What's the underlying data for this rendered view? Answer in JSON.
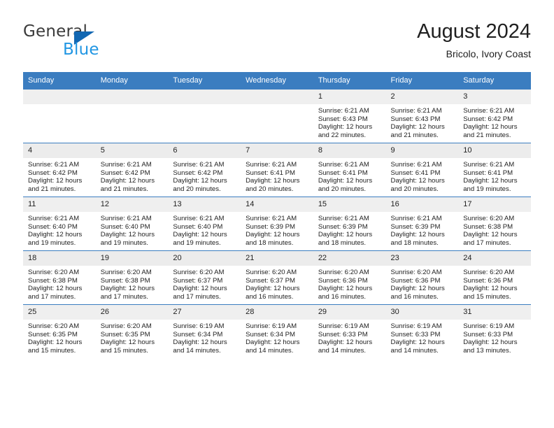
{
  "brand": {
    "name_top": "General",
    "name_bottom": "Blue",
    "accent_dark": "#1267b2",
    "accent_light": "#2196e3"
  },
  "header": {
    "title": "August 2024",
    "subtitle": "Bricolo, Ivory Coast",
    "header_bg": "#3b7dc0"
  },
  "calendar": {
    "weekday_headers": [
      "Sunday",
      "Monday",
      "Tuesday",
      "Wednesday",
      "Thursday",
      "Friday",
      "Saturday"
    ],
    "weeks": [
      [
        {
          "day": "",
          "lines": []
        },
        {
          "day": "",
          "lines": []
        },
        {
          "day": "",
          "lines": []
        },
        {
          "day": "",
          "lines": []
        },
        {
          "day": "1",
          "lines": [
            "Sunrise: 6:21 AM",
            "Sunset: 6:43 PM",
            "Daylight: 12 hours",
            "and 22 minutes."
          ]
        },
        {
          "day": "2",
          "lines": [
            "Sunrise: 6:21 AM",
            "Sunset: 6:43 PM",
            "Daylight: 12 hours",
            "and 21 minutes."
          ]
        },
        {
          "day": "3",
          "lines": [
            "Sunrise: 6:21 AM",
            "Sunset: 6:42 PM",
            "Daylight: 12 hours",
            "and 21 minutes."
          ]
        }
      ],
      [
        {
          "day": "4",
          "lines": [
            "Sunrise: 6:21 AM",
            "Sunset: 6:42 PM",
            "Daylight: 12 hours",
            "and 21 minutes."
          ]
        },
        {
          "day": "5",
          "lines": [
            "Sunrise: 6:21 AM",
            "Sunset: 6:42 PM",
            "Daylight: 12 hours",
            "and 21 minutes."
          ]
        },
        {
          "day": "6",
          "lines": [
            "Sunrise: 6:21 AM",
            "Sunset: 6:42 PM",
            "Daylight: 12 hours",
            "and 20 minutes."
          ]
        },
        {
          "day": "7",
          "lines": [
            "Sunrise: 6:21 AM",
            "Sunset: 6:41 PM",
            "Daylight: 12 hours",
            "and 20 minutes."
          ]
        },
        {
          "day": "8",
          "lines": [
            "Sunrise: 6:21 AM",
            "Sunset: 6:41 PM",
            "Daylight: 12 hours",
            "and 20 minutes."
          ]
        },
        {
          "day": "9",
          "lines": [
            "Sunrise: 6:21 AM",
            "Sunset: 6:41 PM",
            "Daylight: 12 hours",
            "and 20 minutes."
          ]
        },
        {
          "day": "10",
          "lines": [
            "Sunrise: 6:21 AM",
            "Sunset: 6:41 PM",
            "Daylight: 12 hours",
            "and 19 minutes."
          ]
        }
      ],
      [
        {
          "day": "11",
          "lines": [
            "Sunrise: 6:21 AM",
            "Sunset: 6:40 PM",
            "Daylight: 12 hours",
            "and 19 minutes."
          ]
        },
        {
          "day": "12",
          "lines": [
            "Sunrise: 6:21 AM",
            "Sunset: 6:40 PM",
            "Daylight: 12 hours",
            "and 19 minutes."
          ]
        },
        {
          "day": "13",
          "lines": [
            "Sunrise: 6:21 AM",
            "Sunset: 6:40 PM",
            "Daylight: 12 hours",
            "and 19 minutes."
          ]
        },
        {
          "day": "14",
          "lines": [
            "Sunrise: 6:21 AM",
            "Sunset: 6:39 PM",
            "Daylight: 12 hours",
            "and 18 minutes."
          ]
        },
        {
          "day": "15",
          "lines": [
            "Sunrise: 6:21 AM",
            "Sunset: 6:39 PM",
            "Daylight: 12 hours",
            "and 18 minutes."
          ]
        },
        {
          "day": "16",
          "lines": [
            "Sunrise: 6:21 AM",
            "Sunset: 6:39 PM",
            "Daylight: 12 hours",
            "and 18 minutes."
          ]
        },
        {
          "day": "17",
          "lines": [
            "Sunrise: 6:20 AM",
            "Sunset: 6:38 PM",
            "Daylight: 12 hours",
            "and 17 minutes."
          ]
        }
      ],
      [
        {
          "day": "18",
          "lines": [
            "Sunrise: 6:20 AM",
            "Sunset: 6:38 PM",
            "Daylight: 12 hours",
            "and 17 minutes."
          ]
        },
        {
          "day": "19",
          "lines": [
            "Sunrise: 6:20 AM",
            "Sunset: 6:38 PM",
            "Daylight: 12 hours",
            "and 17 minutes."
          ]
        },
        {
          "day": "20",
          "lines": [
            "Sunrise: 6:20 AM",
            "Sunset: 6:37 PM",
            "Daylight: 12 hours",
            "and 17 minutes."
          ]
        },
        {
          "day": "21",
          "lines": [
            "Sunrise: 6:20 AM",
            "Sunset: 6:37 PM",
            "Daylight: 12 hours",
            "and 16 minutes."
          ]
        },
        {
          "day": "22",
          "lines": [
            "Sunrise: 6:20 AM",
            "Sunset: 6:36 PM",
            "Daylight: 12 hours",
            "and 16 minutes."
          ]
        },
        {
          "day": "23",
          "lines": [
            "Sunrise: 6:20 AM",
            "Sunset: 6:36 PM",
            "Daylight: 12 hours",
            "and 16 minutes."
          ]
        },
        {
          "day": "24",
          "lines": [
            "Sunrise: 6:20 AM",
            "Sunset: 6:36 PM",
            "Daylight: 12 hours",
            "and 15 minutes."
          ]
        }
      ],
      [
        {
          "day": "25",
          "lines": [
            "Sunrise: 6:20 AM",
            "Sunset: 6:35 PM",
            "Daylight: 12 hours",
            "and 15 minutes."
          ]
        },
        {
          "day": "26",
          "lines": [
            "Sunrise: 6:20 AM",
            "Sunset: 6:35 PM",
            "Daylight: 12 hours",
            "and 15 minutes."
          ]
        },
        {
          "day": "27",
          "lines": [
            "Sunrise: 6:19 AM",
            "Sunset: 6:34 PM",
            "Daylight: 12 hours",
            "and 14 minutes."
          ]
        },
        {
          "day": "28",
          "lines": [
            "Sunrise: 6:19 AM",
            "Sunset: 6:34 PM",
            "Daylight: 12 hours",
            "and 14 minutes."
          ]
        },
        {
          "day": "29",
          "lines": [
            "Sunrise: 6:19 AM",
            "Sunset: 6:33 PM",
            "Daylight: 12 hours",
            "and 14 minutes."
          ]
        },
        {
          "day": "30",
          "lines": [
            "Sunrise: 6:19 AM",
            "Sunset: 6:33 PM",
            "Daylight: 12 hours",
            "and 14 minutes."
          ]
        },
        {
          "day": "31",
          "lines": [
            "Sunrise: 6:19 AM",
            "Sunset: 6:33 PM",
            "Daylight: 12 hours",
            "and 13 minutes."
          ]
        }
      ]
    ]
  }
}
